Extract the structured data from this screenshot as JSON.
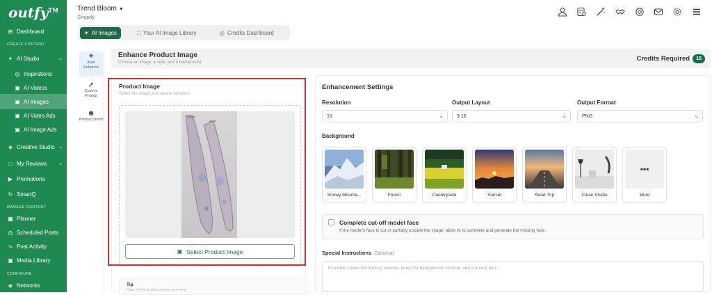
{
  "sidebar": {
    "logo": "outfy",
    "logo_tm": "TM",
    "sections": {
      "create": "CREATE CONTENT",
      "manage": "MANAGE CONTENT",
      "configure": "CONFIGURE"
    },
    "items": [
      {
        "label": "Dashboard",
        "icon": "grid-icon"
      },
      {
        "label": "AI Studio",
        "icon": "sparkle-icon"
      },
      {
        "label": "Inspirations",
        "icon": "globe-icon"
      },
      {
        "label": "AI Videos",
        "icon": "video-icon"
      },
      {
        "label": "AI Images",
        "icon": "image-icon"
      },
      {
        "label": "AI Video Ads",
        "icon": "video-ad-icon"
      },
      {
        "label": "AI Image Ads",
        "icon": "image-ad-icon"
      },
      {
        "label": "Creative Studio",
        "icon": "palette-icon"
      },
      {
        "label": "My Reviews",
        "icon": "chat-icon"
      },
      {
        "label": "Promotions",
        "icon": "megaphone-icon"
      },
      {
        "label": "SmartQ",
        "icon": "refresh-icon"
      },
      {
        "label": "Planner",
        "icon": "calendar-icon"
      },
      {
        "label": "Scheduled Posts",
        "icon": "clock-icon"
      },
      {
        "label": "Post Activity",
        "icon": "activity-icon"
      },
      {
        "label": "Media Library",
        "icon": "folder-icon"
      },
      {
        "label": "Networks",
        "icon": "network-icon"
      }
    ]
  },
  "topbar": {
    "store_name": "Trend Bloom",
    "platform": "Shopify"
  },
  "tabs": [
    {
      "label": "AI Images"
    },
    {
      "label": "Your AI Image Library"
    },
    {
      "label": "Credits Dashboard"
    }
  ],
  "rail": [
    {
      "label": "Auto Enhance"
    },
    {
      "label": "Custom Prompt"
    },
    {
      "label": "Product shoot"
    }
  ],
  "header": {
    "title": "Enhance Product Image",
    "subtitle": "Choose an image, a style, and a background.",
    "credits_label": "Credits Required",
    "credits_value": "15"
  },
  "product_image": {
    "label": "Product Image",
    "hint": "Select the image you want to enhance",
    "button": "Select Product Image"
  },
  "tip": {
    "title": "Tip",
    "text": "Clear well-lit product images work best"
  },
  "settings": {
    "title": "Enhancement Settings",
    "resolution_label": "Resolution",
    "resolution_value": "1K",
    "layout_label": "Output Layout",
    "layout_value": "9:16",
    "format_label": "Output Format",
    "format_value": "PNG",
    "background_label": "Background",
    "backgrounds": [
      {
        "label": "Snowy Mounta..."
      },
      {
        "label": "Forest"
      },
      {
        "label": "Countryside"
      },
      {
        "label": "Sunset"
      },
      {
        "label": "Road Trip"
      },
      {
        "label": "Clean Studio"
      },
      {
        "label": "More"
      }
    ],
    "face_title": "Complete cut-off model face",
    "face_desc": "If the model's face is cut or partially outside the image, allow AI to complete and generate the missing face.",
    "instructions_label": "Special Instructions",
    "instructions_optional": "Optional",
    "instructions_placeholder": "Example: make the lighting warmer, keep the background minimal, add a luxury feel..."
  }
}
